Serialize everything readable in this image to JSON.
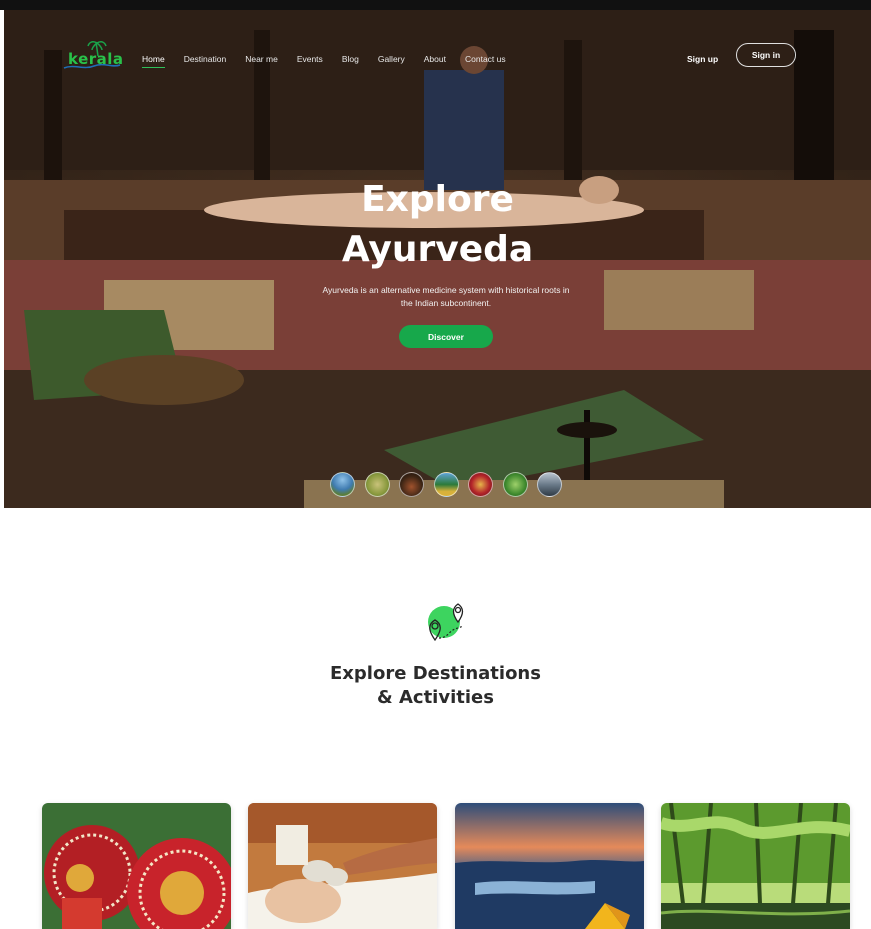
{
  "nav": {
    "logo_text": "kerala",
    "links": [
      "Home",
      "Destination",
      "Near me",
      "Events",
      "Blog",
      "Gallery",
      "About",
      "Contact us"
    ],
    "signup_label": "Sign up",
    "signin_label": "Sign in"
  },
  "hero": {
    "title_line1": "Explore",
    "title_line2": "Ayurveda",
    "subtitle": "Ayurveda is an alternative medicine system with historical roots in the Indian subcontinent.",
    "cta_label": "Discover"
  },
  "section": {
    "title_line1": "Explore Destinations",
    "title_line2": "& Activities"
  },
  "colors": {
    "accent_green": "#17a84b",
    "title_dark": "#2b2b2b"
  }
}
